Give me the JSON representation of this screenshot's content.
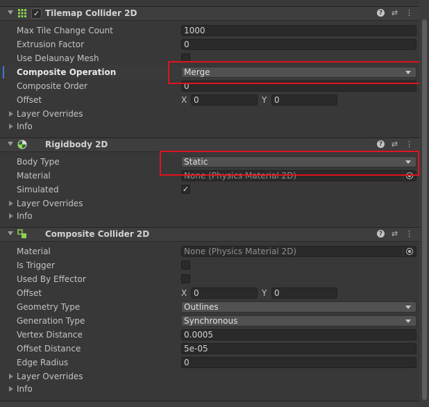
{
  "tilemap_collider": {
    "title": "Tilemap Collider 2D",
    "enabled": "✓",
    "fields": {
      "max_tile_change_count": {
        "label": "Max Tile Change Count",
        "value": "1000"
      },
      "extrusion_factor": {
        "label": "Extrusion Factor",
        "value": "0"
      },
      "use_delaunay_mesh": {
        "label": "Use Delaunay Mesh",
        "checked": false
      },
      "composite_operation": {
        "label": "Composite Operation",
        "value": "Merge"
      },
      "composite_order": {
        "label": "Composite Order",
        "value": "0"
      },
      "offset": {
        "label": "Offset",
        "x_label": "X",
        "x": "0",
        "y_label": "Y",
        "y": "0"
      },
      "layer_overrides": {
        "label": "Layer Overrides"
      },
      "info": {
        "label": "Info"
      }
    }
  },
  "rigidbody": {
    "title": "Rigidbody 2D",
    "fields": {
      "body_type": {
        "label": "Body Type",
        "value": "Static"
      },
      "material": {
        "label": "Material",
        "value": "None (Physics Material 2D)"
      },
      "simulated": {
        "label": "Simulated",
        "checked": true,
        "mark": "✓"
      },
      "layer_overrides": {
        "label": "Layer Overrides"
      },
      "info": {
        "label": "Info"
      }
    }
  },
  "composite_collider": {
    "title": "Composite Collider 2D",
    "fields": {
      "material": {
        "label": "Material",
        "value": "None (Physics Material 2D)"
      },
      "is_trigger": {
        "label": "Is Trigger",
        "checked": false
      },
      "used_by_effector": {
        "label": "Used By Effector",
        "checked": false
      },
      "offset": {
        "label": "Offset",
        "x_label": "X",
        "x": "0",
        "y_label": "Y",
        "y": "0"
      },
      "geometry_type": {
        "label": "Geometry Type",
        "value": "Outlines"
      },
      "generation_type": {
        "label": "Generation Type",
        "value": "Synchronous"
      },
      "vertex_distance": {
        "label": "Vertex Distance",
        "value": "0.0005"
      },
      "offset_distance": {
        "label": "Offset Distance",
        "value": "5e-05"
      },
      "edge_radius": {
        "label": "Edge Radius",
        "value": "0"
      },
      "layer_overrides": {
        "label": "Layer Overrides"
      },
      "info": {
        "label": "Info"
      }
    }
  },
  "header_icons": {
    "help": "?",
    "presets": "⇄",
    "menu": "⋮"
  },
  "colors": {
    "highlight": "#e0141e",
    "selection_bar": "#3d7ad6"
  }
}
